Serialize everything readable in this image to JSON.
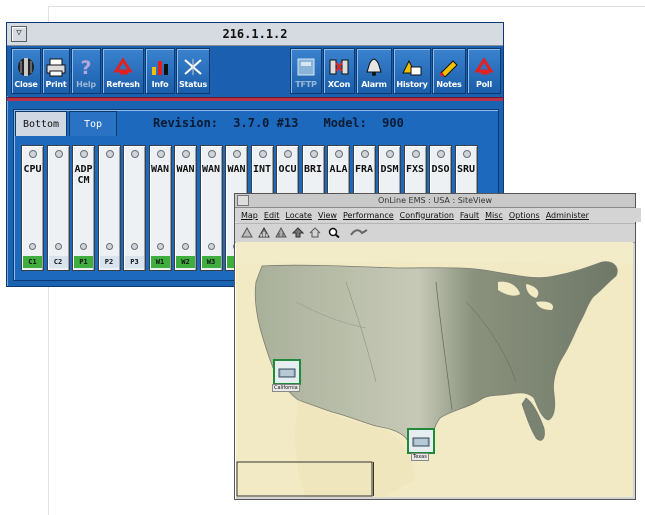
{
  "device_window": {
    "title": "216.1.1.2",
    "menu_button_glyph": "▽",
    "toolbar_left": [
      {
        "label": "Close",
        "icon": "close-icon",
        "enabled": true
      },
      {
        "label": "Print",
        "icon": "print-icon",
        "enabled": true
      },
      {
        "label": "Help",
        "icon": "help-icon",
        "enabled": false
      },
      {
        "label": "Refresh",
        "icon": "refresh-icon",
        "enabled": true
      },
      {
        "label": "Info",
        "icon": "info-icon",
        "enabled": true
      },
      {
        "label": "Status",
        "icon": "status-icon",
        "enabled": true
      }
    ],
    "toolbar_right": [
      {
        "label": "TFTP",
        "icon": "tftp-icon",
        "enabled": false
      },
      {
        "label": "XCon",
        "icon": "xcon-icon",
        "enabled": true
      },
      {
        "label": "Alarm",
        "icon": "alarm-icon",
        "enabled": true
      },
      {
        "label": "History",
        "icon": "history-icon",
        "enabled": true
      },
      {
        "label": "Notes",
        "icon": "notes-icon",
        "enabled": true
      },
      {
        "label": "Poll",
        "icon": "poll-icon",
        "enabled": true
      }
    ],
    "tabs": [
      {
        "label": "Bottom",
        "active": true
      },
      {
        "label": "Top",
        "active": false
      }
    ],
    "revision_label": "Revision:",
    "revision_value": "3.7.0 #13",
    "model_label": "Model:",
    "model_value": "900",
    "slots": [
      {
        "card": "CPU",
        "slot": "C1",
        "color": "#3fae3f"
      },
      {
        "card": "",
        "slot": "C2",
        "color": "#d9e3ee"
      },
      {
        "card": "ADPCM",
        "slot": "P1",
        "color": "#3fae3f"
      },
      {
        "card": "",
        "slot": "P2",
        "color": "#d9e3ee"
      },
      {
        "card": "",
        "slot": "P3",
        "color": "#d9e3ee"
      },
      {
        "card": "WAN",
        "slot": "W1",
        "color": "#3fae3f"
      },
      {
        "card": "WAN",
        "slot": "W2",
        "color": "#3fae3f"
      },
      {
        "card": "WAN",
        "slot": "W3",
        "color": "#3fae3f"
      },
      {
        "card": "WAN",
        "slot": "",
        "color": "#3fae3f"
      },
      {
        "card": "INT",
        "slot": "",
        "color": "#3fae3f"
      },
      {
        "card": "OCU",
        "slot": "",
        "color": "#3fae3f"
      },
      {
        "card": "BRI",
        "slot": "",
        "color": "#3fae3f"
      },
      {
        "card": "ALA",
        "slot": "",
        "color": "#3fae3f"
      },
      {
        "card": "FRA",
        "slot": "",
        "color": "#3fae3f"
      },
      {
        "card": "DSM",
        "slot": "",
        "color": "#3fae3f"
      },
      {
        "card": "FXS",
        "slot": "",
        "color": "#3fae3f"
      },
      {
        "card": "DSO",
        "slot": "",
        "color": "#3fae3f"
      },
      {
        "card": "SRU",
        "slot": "",
        "color": "#3fae3f"
      }
    ]
  },
  "map_window": {
    "title": "OnLine EMS : USA : SiteView",
    "menu": [
      "Map",
      "Edit",
      "Locate",
      "View",
      "Performance",
      "Configuration",
      "Fault",
      "Misc",
      "Options",
      "Administer"
    ],
    "toolbar_icons": [
      "select-icon",
      "network-icon",
      "network-alt-icon",
      "up-arrow-icon",
      "home-icon",
      "zoom-icon",
      "link-icon"
    ],
    "sites": [
      {
        "name": "California"
      },
      {
        "name": "Texas"
      }
    ],
    "colors": {
      "land": "#9aa38a",
      "water": "#f2eac4",
      "site_border": "#1f8a3a"
    }
  }
}
